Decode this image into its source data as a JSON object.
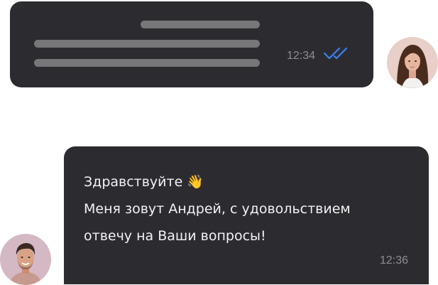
{
  "chat": {
    "outgoing": {
      "time": "12:34",
      "status_icon": "double-check-icon",
      "status_color": "#3b82f6",
      "avatar": "woman-avatar"
    },
    "incoming": {
      "line1": "Здравствуйте 👋",
      "line2": "Меня зовут Андрей, с удовольствием",
      "line3": "отвечу на Ваши вопросы!",
      "time": "12:36",
      "avatar": "man-avatar"
    }
  },
  "colors": {
    "bubble": "#2c2c30",
    "placeholder": "#77777a",
    "text": "#f2f2f5",
    "time": "#8d8d93"
  }
}
